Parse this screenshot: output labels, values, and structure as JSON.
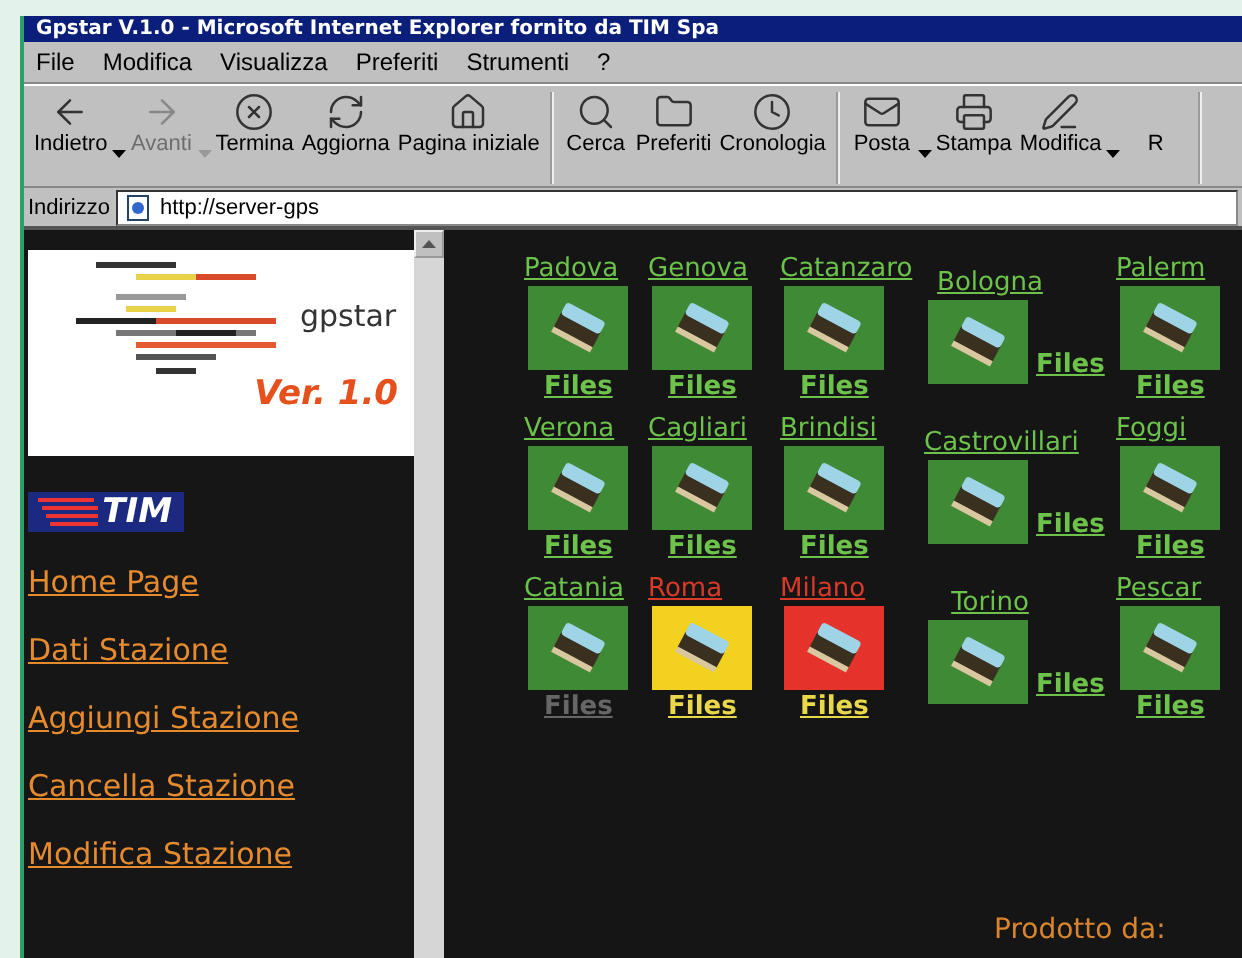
{
  "window": {
    "title": "Gpstar V.1.0 - Microsoft Internet Explorer fornito da TIM Spa"
  },
  "menu": [
    "File",
    "Modifica",
    "Visualizza",
    "Preferiti",
    "Strumenti",
    "?"
  ],
  "toolbar": {
    "groups": [
      [
        {
          "label": "Indietro",
          "dropdown": true,
          "disabled": false
        },
        {
          "label": "Avanti",
          "dropdown": true,
          "disabled": true
        },
        {
          "label": "Termina",
          "dropdown": false,
          "disabled": false
        },
        {
          "label": "Aggiorna",
          "dropdown": false,
          "disabled": false
        },
        {
          "label": "Pagina iniziale",
          "dropdown": false,
          "disabled": false
        }
      ],
      [
        {
          "label": "Cerca",
          "dropdown": false,
          "disabled": false
        },
        {
          "label": "Preferiti",
          "dropdown": false,
          "disabled": false
        },
        {
          "label": "Cronologia",
          "dropdown": false,
          "disabled": false
        }
      ],
      [
        {
          "label": "Posta",
          "dropdown": true,
          "disabled": false
        },
        {
          "label": "Stampa",
          "dropdown": false,
          "disabled": false
        },
        {
          "label": "Modifica",
          "dropdown": true,
          "disabled": false
        },
        {
          "label": "R",
          "dropdown": false,
          "disabled": false
        }
      ]
    ]
  },
  "address": {
    "label": "Indirizzo",
    "value": "http://server-gps"
  },
  "sidebar": {
    "logo_text": "gpstar",
    "version": "Ver. 1.0",
    "tim": "TIM",
    "links": [
      "Home Page",
      "Dati Stazione",
      "Aggiungi Stazione",
      "Cancella Stazione",
      "Modifica Stazione"
    ]
  },
  "station_columns": [
    {
      "kind": "stacked",
      "stations": [
        {
          "name": "Padova",
          "color": "#3f8a34",
          "alert": false,
          "files": "Files",
          "files_disabled": false
        },
        {
          "name": "Verona",
          "color": "#3f8a34",
          "alert": false,
          "files": "Files",
          "files_disabled": false
        },
        {
          "name": "Catania",
          "color": "#3f8a34",
          "alert": false,
          "files": "Files",
          "files_disabled": true
        }
      ]
    },
    {
      "kind": "stacked",
      "stations": [
        {
          "name": "Genova",
          "color": "#3f8a34",
          "alert": false,
          "files": "Files",
          "files_disabled": false
        },
        {
          "name": "Cagliari",
          "color": "#3f8a34",
          "alert": false,
          "files": "Files",
          "files_disabled": false
        },
        {
          "name": "Roma",
          "color": "#f2d21e",
          "alert": true,
          "files": "Files",
          "files_disabled": false
        }
      ]
    },
    {
      "kind": "stacked",
      "stations": [
        {
          "name": "Catanzaro",
          "color": "#3f8a34",
          "alert": false,
          "files": "Files",
          "files_disabled": false
        },
        {
          "name": "Brindisi",
          "color": "#3f8a34",
          "alert": false,
          "files": "Files",
          "files_disabled": false
        },
        {
          "name": "Milano",
          "color": "#e5322a",
          "alert": true,
          "files": "Files",
          "files_disabled": false
        }
      ]
    },
    {
      "kind": "side",
      "stations": [
        {
          "name": "Bologna",
          "color": "#3f8a34",
          "alert": false,
          "files": "Files",
          "files_disabled": false
        },
        {
          "name": "Castrovillari",
          "color": "#3f8a34",
          "alert": false,
          "files": "Files",
          "files_disabled": false
        },
        {
          "name": "Torino",
          "color": "#3f8a34",
          "alert": false,
          "files": "Files",
          "files_disabled": false
        }
      ]
    },
    {
      "kind": "stacked",
      "stations": [
        {
          "name": "Palerm",
          "color": "#3f8a34",
          "alert": false,
          "files": "Files",
          "files_disabled": false
        },
        {
          "name": "Foggi",
          "color": "#3f8a34",
          "alert": false,
          "files": "Files",
          "files_disabled": false
        },
        {
          "name": "Pescar",
          "color": "#3f8a34",
          "alert": false,
          "files": "Files",
          "files_disabled": false
        }
      ]
    }
  ],
  "footer": "Prodotto da:"
}
